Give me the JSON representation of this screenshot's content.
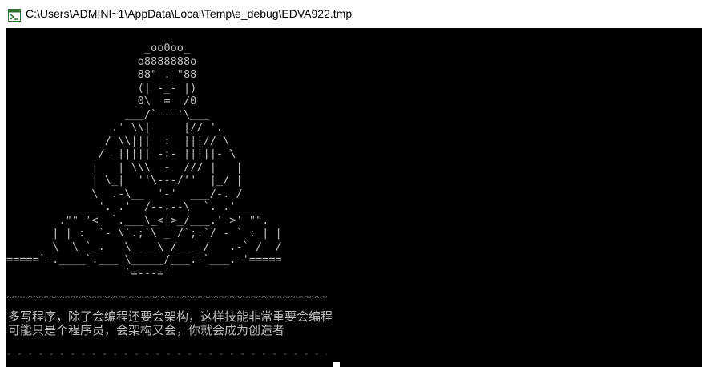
{
  "window": {
    "title": "C:\\Users\\ADMINI~1\\AppData\\Local\\Temp\\e_debug\\EDVA922.tmp",
    "icon": "console-app-icon"
  },
  "console": {
    "ascii_art": "                     _oo0oo_\n                    o8888888o\n                    88\" . \"88\n                    (| -_- |)\n                    0\\  =  /0\n                  ___/`---'\\___\n                .' \\\\|     |// '.\n               / \\\\|||  :  |||// \\\n              / _||||| -:- |||||- \\\n             |   | \\\\\\  -  /// |   |\n             | \\_|  ''\\---/''  |_/ |\n             \\  .-\\__  '-'  ___/-. /\n           ___'. .'  /--.--\\  `. .'___\n        .\"\" '<  `.___\\_<|>_/___.' >' \"\".\n       | | :  `- \\`.;`\\ _ /`;.`/ - ` : | |\n       \\  \\ `_.   \\_ __\\ /__ _/   .-` /  /\n=====`-.____`.___ \\_____/___.-`___.-'=====\n                  `=---='",
    "separator": "^^^^^^^^^^^^^^^^^^^^^^^^^^^^^^^^^^^^^^^^^^^^^^^^^^^^^^^^^^^^^^^^^^^^^^^^",
    "message": "多写程序，除了会编程还要会架构，这样技能非常重要会编程可能只是个程序员，会架构又会，你就会成为创造者",
    "bottom_rule": "- - - - - - - - - - - - - - - - - - - - - - - - - - - - - - - - - - - - - - - - - - - - - - - - -"
  },
  "colors": {
    "console_bg": "#000000",
    "console_text": "#c0c0c0",
    "titlebar_bg": "#ffffff"
  }
}
